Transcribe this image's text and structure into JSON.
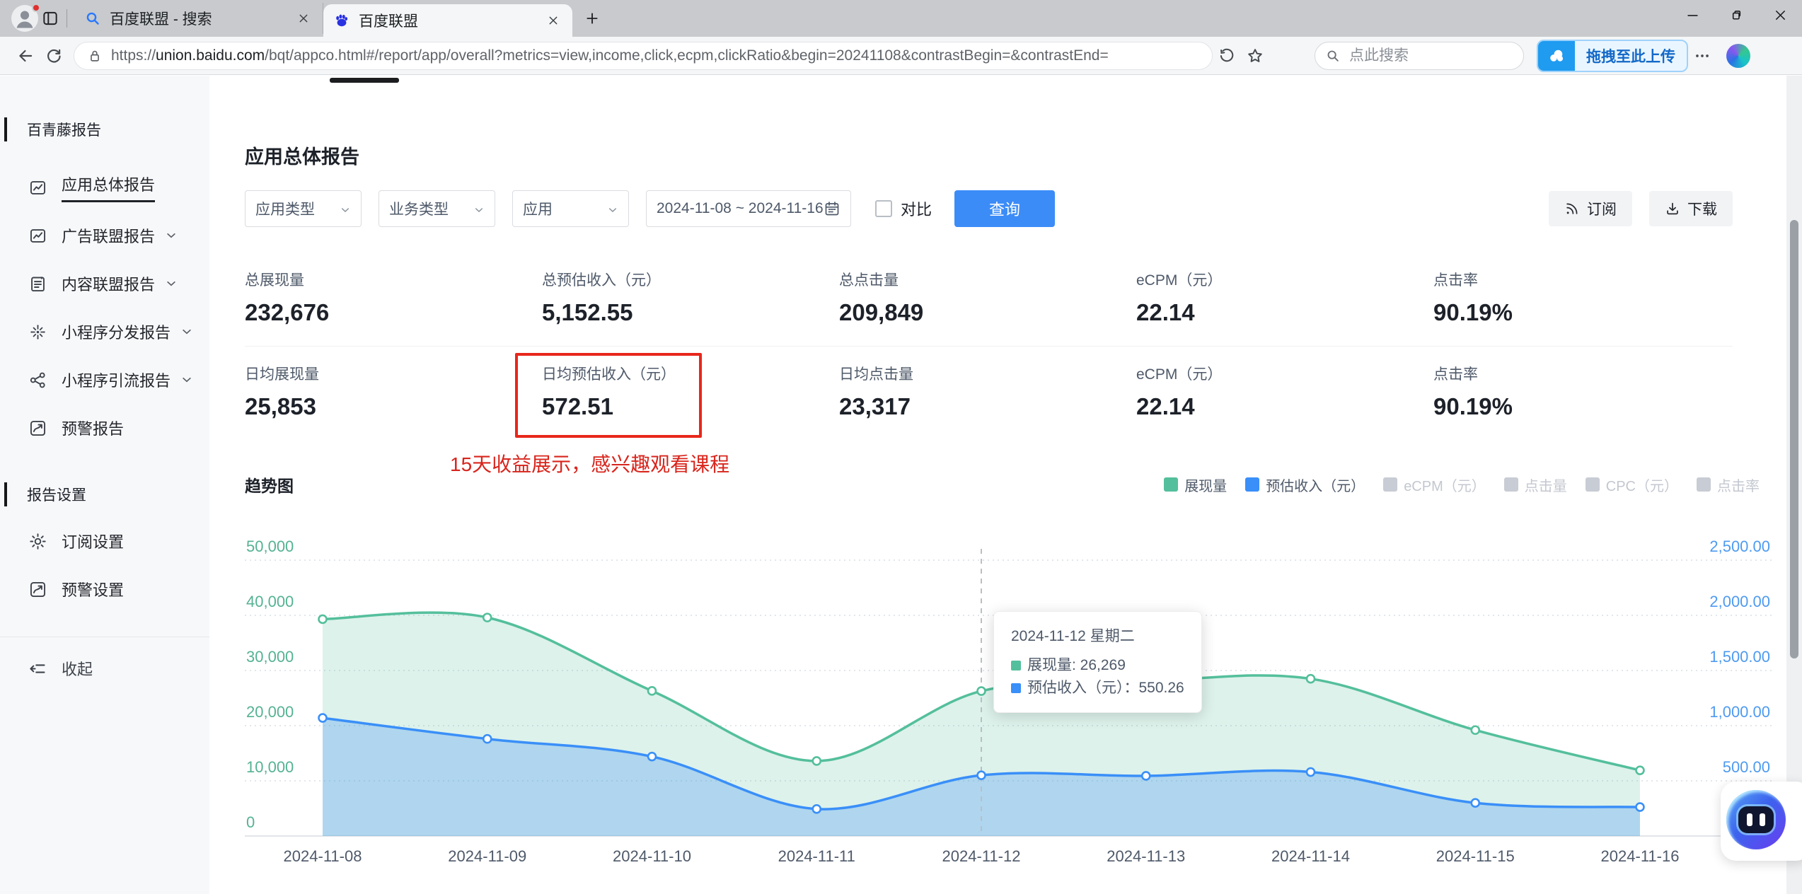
{
  "browser": {
    "tabs": [
      {
        "title": "百度联盟 - 搜索",
        "favicon": "search-favicon",
        "active": false
      },
      {
        "title": "百度联盟",
        "favicon": "baidu-paw-favicon",
        "active": true
      }
    ],
    "url_scheme": "https://",
    "url_domain": "union.baidu.com",
    "url_path": "/bqt/appco.html#/report/app/overall?metrics=view,income,click,ecpm,clickRatio&begin=20241108&contrastBegin=&contrastEnd=",
    "search_placeholder": "点此搜索",
    "upload_button_label": "拖拽至此上传"
  },
  "sidebar": {
    "sections": [
      {
        "header": "百青藤报告",
        "items": [
          {
            "key": "app-overall-report",
            "label": "应用总体报告",
            "icon": "report-chart",
            "active": true,
            "chevron": false
          },
          {
            "key": "ad-union-report",
            "label": "广告联盟报告",
            "icon": "report-chart",
            "active": false,
            "chevron": true
          },
          {
            "key": "content-union-report",
            "label": "内容联盟报告",
            "icon": "doc-badge",
            "active": false,
            "chevron": true
          },
          {
            "key": "miniapp-distribution-report",
            "label": "小程序分发报告",
            "icon": "asterisk",
            "active": false,
            "chevron": true
          },
          {
            "key": "miniapp-traffic-report",
            "label": "小程序引流报告",
            "icon": "share",
            "active": false,
            "chevron": true
          },
          {
            "key": "alert-report",
            "label": "预警报告",
            "icon": "arrow-box",
            "active": false,
            "chevron": false
          }
        ]
      },
      {
        "header": "报告设置",
        "items": [
          {
            "key": "subscription-settings",
            "label": "订阅设置",
            "icon": "gear",
            "active": false,
            "chevron": false
          },
          {
            "key": "alert-settings",
            "label": "预警设置",
            "icon": "arrow-box",
            "active": false,
            "chevron": false
          }
        ]
      }
    ],
    "collapse_label": "收起"
  },
  "main": {
    "page_title": "应用总体报告",
    "chart_title": "趋势图",
    "annotation": "15天收益展示，感兴趣观看课程"
  },
  "filters": {
    "app_type": "应用类型",
    "biz_type": "业务类型",
    "app": "应用",
    "date_range": "2024-11-08 ~ 2024-11-16",
    "compare_label": "对比",
    "query_label": "查询",
    "subscribe_label": "订阅",
    "download_label": "下载"
  },
  "metrics": {
    "row1": [
      {
        "label": "总展现量",
        "value": "232,676"
      },
      {
        "label": "总预估收入（元）",
        "value": "5,152.55"
      },
      {
        "label": "总点击量",
        "value": "209,849"
      },
      {
        "label": "eCPM（元）",
        "value": "22.14"
      },
      {
        "label": "点击率",
        "value": "90.19%"
      }
    ],
    "row2": [
      {
        "label": "日均展现量",
        "value": "25,853"
      },
      {
        "label": "日均预估收入（元）",
        "value": "572.51",
        "highlighted": true
      },
      {
        "label": "日均点击量",
        "value": "23,317"
      },
      {
        "label": "eCPM（元）",
        "value": "22.14"
      },
      {
        "label": "点击率",
        "value": "90.19%"
      }
    ]
  },
  "chart_data": {
    "type": "area",
    "title": "趋势图",
    "x": [
      "2024-11-08",
      "2024-11-09",
      "2024-11-10",
      "2024-11-11",
      "2024-11-12",
      "2024-11-13",
      "2024-11-14",
      "2024-11-15",
      "2024-11-16"
    ],
    "series": [
      {
        "name": "展现量",
        "axis": "left",
        "color": "#54bf9c",
        "fill": "rgba(84,191,156,0.20)",
        "values": [
          39300,
          39600,
          26300,
          13600,
          26269,
          28000,
          28500,
          19200,
          11900
        ]
      },
      {
        "name": "预估收入（元）",
        "axis": "right",
        "color": "#3a8ff8",
        "fill": "rgba(58,143,248,0.28)",
        "values": [
          1070,
          880,
          720,
          245,
          550.26,
          545,
          580,
          300,
          262.29
        ]
      }
    ],
    "left_axis": {
      "max": 50000,
      "color": "#55b292",
      "ticks": [
        "50,000",
        "40,000",
        "30,000",
        "20,000",
        "10,000",
        "0"
      ]
    },
    "right_axis": {
      "max": 2500,
      "color": "#4e9af0",
      "ticks": [
        "2,500.00",
        "2,000.00",
        "1,500.00",
        "1,000.00",
        "500.00",
        "0"
      ]
    },
    "grid": true,
    "legend_position": "top-right",
    "legend": [
      {
        "label": "展现量",
        "color": "#54bf9c",
        "active": true
      },
      {
        "label": "预估收入（元）",
        "color": "#3a8ff8",
        "active": true
      },
      {
        "label": "eCPM（元）",
        "color": "#c8ccd4",
        "active": false
      },
      {
        "label": "点击量",
        "color": "#c8ccd4",
        "active": false
      },
      {
        "label": "CPC（元）",
        "color": "#c8ccd4",
        "active": false
      },
      {
        "label": "点击率",
        "color": "#c8ccd4",
        "active": false
      }
    ],
    "tooltip": {
      "index": 4,
      "title": "2024-11-12 星期二",
      "rows": [
        {
          "color": "#54bf9c",
          "text": "展现量: 26,269"
        },
        {
          "color": "#3a8ff8",
          "text": "预估收入（元）：550.26"
        }
      ]
    }
  }
}
